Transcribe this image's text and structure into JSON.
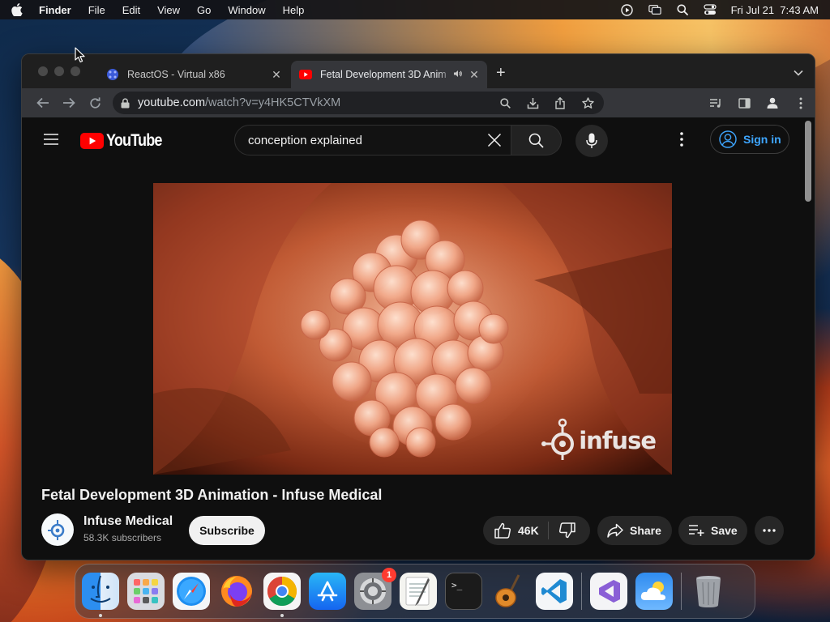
{
  "menubar": {
    "app": "Finder",
    "items": [
      "File",
      "Edit",
      "View",
      "Go",
      "Window",
      "Help"
    ],
    "clock": "Fri Jul 21  7:43 AM"
  },
  "browser": {
    "tabs": [
      {
        "title": "ReactOS - Virtual x86",
        "active": false
      },
      {
        "title": "Fetal Development 3D Anim",
        "active": true,
        "playing_audio": true
      }
    ],
    "new_tab": "+",
    "url_host": "youtube.com",
    "url_path": "/watch?v=y4HK5CTVkXM"
  },
  "youtube": {
    "logo_text": "YouTube",
    "search_query": "conception explained",
    "sign_in": "Sign in",
    "video": {
      "title": "Fetal Development 3D Animation - Infuse Medical",
      "watermark": "infuse"
    },
    "channel": {
      "name": "Infuse Medical",
      "subscribers": "58.3K subscribers"
    },
    "actions": {
      "subscribe": "Subscribe",
      "likes": "46K",
      "share": "Share",
      "save": "Save"
    }
  },
  "dock": {
    "apps": [
      {
        "name": "finder-icon",
        "running": true
      },
      {
        "name": "launchpad-icon",
        "running": false
      },
      {
        "name": "safari-icon",
        "running": false
      },
      {
        "name": "firefox-icon",
        "running": false
      },
      {
        "name": "chrome-icon",
        "running": true
      },
      {
        "name": "app-store-icon",
        "running": false
      },
      {
        "name": "system-settings-icon",
        "running": false,
        "badge": "1"
      },
      {
        "name": "textedit-icon",
        "running": false
      },
      {
        "name": "terminal-icon",
        "running": false
      },
      {
        "name": "garageband-icon",
        "running": false
      },
      {
        "name": "vscode-icon",
        "running": false
      },
      {
        "name": "visual-studio-icon",
        "running": false
      },
      {
        "name": "weather-icon",
        "running": false
      },
      {
        "name": "trash-icon",
        "running": false
      }
    ]
  },
  "colors": {
    "youtube_red": "#ff0000",
    "link_blue": "#3ea6ff",
    "page_bg": "#0f0f0f"
  }
}
